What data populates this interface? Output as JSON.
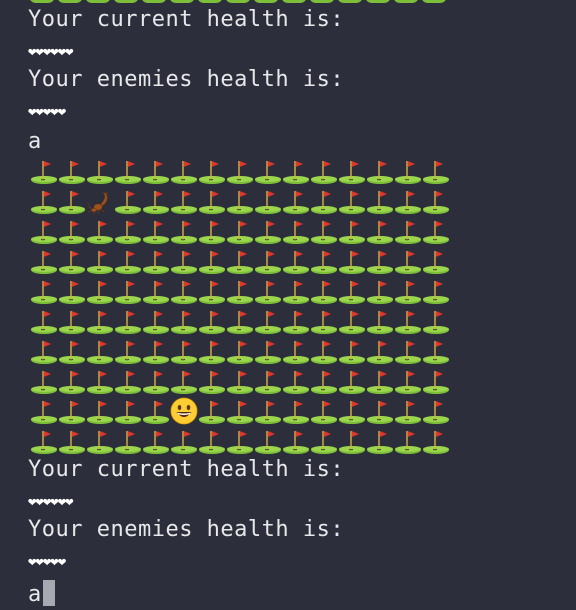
{
  "terminal": {
    "blocks": [
      {
        "current_label": "Your current health is:",
        "current_hearts": "❤❤❤❤❤❤",
        "enemy_label": "Your enemies health is:",
        "enemy_hearts": "❤❤❤❤❤",
        "input": "a"
      },
      {
        "current_label": "Your current health is:",
        "current_hearts": "❤❤❤❤❤❤",
        "enemy_label": "Your enemies health is:",
        "enemy_hearts": "❤❤❤❤❤",
        "input": "a"
      }
    ]
  },
  "board": {
    "columns": 15,
    "rows": 10,
    "tile_icon": "golf-flag-tile-icon",
    "enemy": {
      "icon": "scorpion-icon",
      "row": 1,
      "col": 2
    },
    "player": {
      "icon": "grinning-face-icon",
      "row": 8,
      "col": 5
    },
    "colors": {
      "background": "#2c2f3b",
      "grass": "#7cbd3a",
      "flag": "#e0362c",
      "pole": "#d9b24a"
    }
  }
}
